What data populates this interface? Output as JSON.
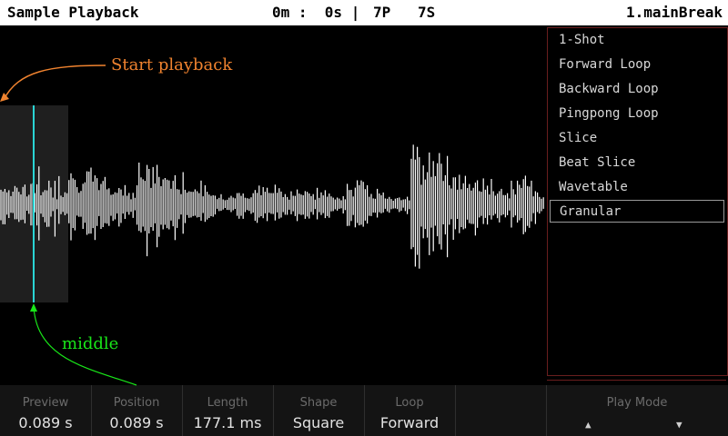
{
  "header": {
    "title": "Sample Playback",
    "time": "0m :  0s |",
    "patterns": "7P",
    "steps": "7S",
    "sample_name": "1.mainBreak"
  },
  "menu": {
    "items": [
      "1-Shot",
      "Forward Loop",
      "Backward Loop",
      "Pingpong Loop",
      "Slice",
      "Beat Slice",
      "Wavetable",
      "Granular"
    ],
    "selected_index": 7
  },
  "footer": {
    "params": [
      {
        "label": "Preview",
        "value": "0.089 s"
      },
      {
        "label": "Position",
        "value": "0.089 s"
      },
      {
        "label": "Length",
        "value": "177.1 ms"
      },
      {
        "label": "Shape",
        "value": "Square"
      },
      {
        "label": "Loop",
        "value": "Forward"
      }
    ],
    "play_mode_label": "Play Mode",
    "up_icon": "triangle-up-icon",
    "down_icon": "triangle-down-icon"
  },
  "annotations": {
    "start": "Start playback",
    "middle": "middle"
  },
  "colors": {
    "header_bg": "#ffffff",
    "background": "#000000",
    "waveform": "#ffffff",
    "playhead": "#2ad4d4",
    "selection": "#1f1f1f",
    "menu_border": "#6a1e1e",
    "annotation_start": "#f0832f",
    "annotation_middle": "#19e619"
  }
}
